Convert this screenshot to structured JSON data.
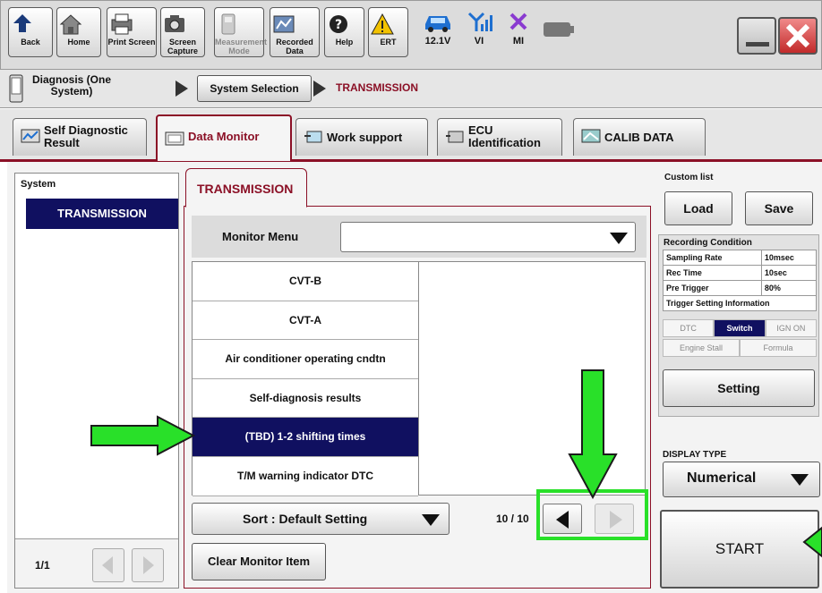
{
  "toolbar": {
    "buttons": [
      {
        "label": "Back",
        "icon": "back-arrow-icon"
      },
      {
        "label": "Home",
        "icon": "home-icon"
      },
      {
        "label": "Print Screen",
        "icon": "printer-icon"
      },
      {
        "label": "Screen Capture",
        "icon": "camera-icon"
      },
      {
        "label": "Measurement Mode",
        "icon": "measurement-icon"
      },
      {
        "label": "Recorded Data",
        "icon": "recorded-data-icon"
      },
      {
        "label": "Help",
        "icon": "help-icon"
      },
      {
        "label": "ERT",
        "icon": "warning-icon"
      }
    ],
    "status": {
      "battery_voltage": "12.1V",
      "vi_label": "VI",
      "mi_label": "MI"
    }
  },
  "breadcrumb": {
    "home_label": "Diagnosis (One System)",
    "step_button": "System Selection",
    "current": "TRANSMISSION"
  },
  "tabs": [
    {
      "label": "Self Diagnostic Result",
      "active": false
    },
    {
      "label": "Data Monitor",
      "active": true
    },
    {
      "label": "Work support",
      "active": false
    },
    {
      "label": "ECU Identification",
      "active": false
    },
    {
      "label": "CALIB DATA",
      "active": false
    }
  ],
  "system_panel": {
    "title": "System",
    "selected_item": "TRANSMISSION",
    "pager": "1/1"
  },
  "monitor": {
    "tab_title": "TRANSMISSION",
    "menu_label": "Monitor Menu",
    "menu_value": "",
    "items": [
      "CVT-B",
      "CVT-A",
      "Air conditioner operating cndtn",
      "Self-diagnosis results",
      "(TBD) 1-2 shifting times",
      "T/M warning indicator DTC"
    ],
    "selected_index": 4,
    "sort_label": "Sort : Default Setting",
    "page_indicator": "10 / 10",
    "clear_button": "Clear Monitor Item"
  },
  "right_panel": {
    "custom_list_label": "Custom list",
    "load": "Load",
    "save": "Save",
    "recording_condition_label": "Recording Condition",
    "rows": [
      {
        "name": "Sampling Rate",
        "value": "10msec"
      },
      {
        "name": "Rec Time",
        "value": "10sec"
      },
      {
        "name": "Pre Trigger",
        "value": "80%"
      }
    ],
    "trigger_label": "Trigger Setting Information",
    "trigger_row1": [
      "DTC",
      "Switch",
      "IGN ON"
    ],
    "trigger_active": "Switch",
    "trigger_row2": [
      "Engine Stall",
      "Formula"
    ],
    "setting_button": "Setting",
    "display_type_label": "DISPLAY TYPE",
    "display_type_value": "Numerical",
    "start_button": "START"
  },
  "colors": {
    "accent": "#8b1026",
    "selected_bg": "#101060",
    "highlight_green": "#29e029"
  }
}
